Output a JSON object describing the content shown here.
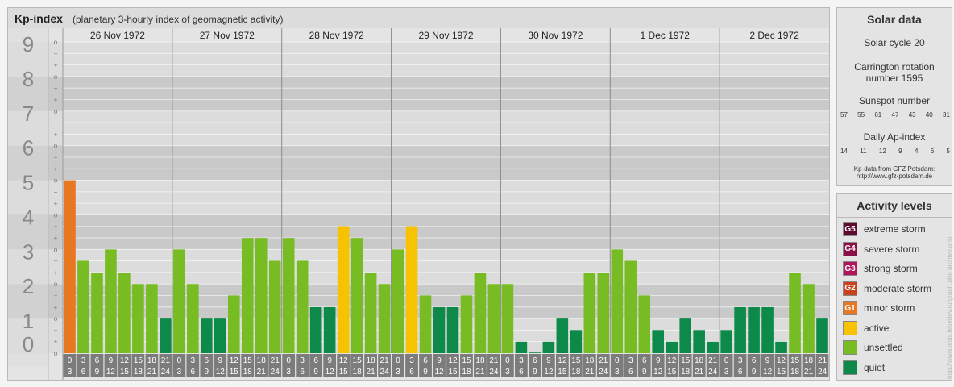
{
  "header": {
    "title": "Kp-index",
    "subtitle": "(planetary 3-hourly index of geomagnetic activity)"
  },
  "chart_data": {
    "type": "bar",
    "title": "Kp-index",
    "subtitle": "(planetary 3-hourly index of geomagnetic activity)",
    "ylim": [
      0,
      9
    ],
    "y_ticks": [
      "0",
      "1",
      "2",
      "3",
      "4",
      "5",
      "6",
      "7",
      "8",
      "9"
    ],
    "minor_tick_labels": [
      "o",
      "+",
      "−"
    ],
    "days": [
      "26 Nov 1972",
      "27 Nov 1972",
      "28 Nov 1972",
      "29 Nov 1972",
      "30 Nov 1972",
      "1 Dec 1972",
      "2 Dec 1972"
    ],
    "interval_labels": [
      [
        "0",
        "3"
      ],
      [
        "3",
        "6"
      ],
      [
        "6",
        "9"
      ],
      [
        "9",
        "12"
      ],
      [
        "12",
        "15"
      ],
      [
        "15",
        "18"
      ],
      [
        "18",
        "21"
      ],
      [
        "21",
        "24"
      ]
    ],
    "values": [
      [
        5.0,
        2.67,
        2.33,
        3.0,
        2.33,
        2.0,
        2.0,
        1.0
      ],
      [
        3.0,
        2.0,
        1.0,
        1.0,
        1.67,
        3.33,
        3.33,
        2.67
      ],
      [
        3.33,
        2.67,
        1.33,
        1.33,
        3.67,
        3.33,
        2.33,
        2.0
      ],
      [
        3.0,
        3.67,
        1.67,
        1.33,
        1.33,
        1.67,
        2.33,
        2.0
      ],
      [
        2.0,
        0.33,
        0.0,
        0.33,
        1.0,
        0.67,
        2.33,
        2.33
      ],
      [
        3.0,
        2.67,
        1.67,
        0.67,
        0.33,
        1.0,
        0.67,
        0.33
      ],
      [
        0.67,
        1.33,
        1.33,
        1.33,
        0.33,
        2.33,
        2.0,
        1.0
      ]
    ],
    "levels": [
      [
        "g1",
        "unsettled",
        "unsettled",
        "unsettled",
        "unsettled",
        "unsettled",
        "unsettled",
        "quiet"
      ],
      [
        "unsettled",
        "unsettled",
        "quiet",
        "quiet",
        "unsettled",
        "unsettled",
        "unsettled",
        "unsettled"
      ],
      [
        "unsettled",
        "unsettled",
        "quiet",
        "quiet",
        "active",
        "unsettled",
        "unsettled",
        "unsettled"
      ],
      [
        "unsettled",
        "active",
        "unsettled",
        "quiet",
        "quiet",
        "unsettled",
        "unsettled",
        "unsettled"
      ],
      [
        "unsettled",
        "quiet",
        "quiet",
        "quiet",
        "quiet",
        "quiet",
        "unsettled",
        "unsettled"
      ],
      [
        "unsettled",
        "unsettled",
        "unsettled",
        "quiet",
        "quiet",
        "quiet",
        "quiet",
        "quiet"
      ],
      [
        "quiet",
        "quiet",
        "quiet",
        "quiet",
        "quiet",
        "unsettled",
        "unsettled",
        "quiet"
      ]
    ],
    "grid": true
  },
  "colors": {
    "quiet": "#0d8a4a",
    "unsettled": "#77bc22",
    "active": "#f7c200",
    "g1": "#e87722",
    "g2": "#c8421d",
    "g3": "#b0155b",
    "g4": "#8a1047",
    "g5": "#5c0a2e",
    "band_dark": "#c9c9c9",
    "band_light": "#dcdcdc"
  },
  "solar": {
    "title": "Solar data",
    "cycle": "Solar cycle 20",
    "carrington_l1": "Carrington rotation",
    "carrington_l2": "number 1595",
    "sunspot_title": "Sunspot number",
    "sunspot_values": [
      "57",
      "55",
      "61",
      "47",
      "43",
      "40",
      "31"
    ],
    "ap_title": "Daily Ap-index",
    "ap_values": [
      "14",
      "11",
      "12",
      "9",
      "4",
      "6",
      "5"
    ],
    "source_l1": "Kp-data from GFZ Potsdam:",
    "source_l2": "http://www.gfz-potsdam.de"
  },
  "legend": {
    "title": "Activity levels",
    "items": [
      {
        "badge": "G5",
        "label": "extreme storm",
        "color": "#5c0a2e"
      },
      {
        "badge": "G4",
        "label": "severe storm",
        "color": "#8a1047"
      },
      {
        "badge": "G3",
        "label": "strong storm",
        "color": "#b0155b"
      },
      {
        "badge": "G2",
        "label": "moderate storm",
        "color": "#c8421d"
      },
      {
        "badge": "G1",
        "label": "minor storm",
        "color": "#e87722"
      },
      {
        "badge": "",
        "label": "active",
        "color": "#f7c200"
      },
      {
        "badge": "",
        "label": "unsettled",
        "color": "#77bc22"
      },
      {
        "badge": "",
        "label": "quiet",
        "color": "#0d8a4a"
      }
    ]
  },
  "watermark": "http://www.tesis.lebedev.ru/graph.php archive.php"
}
